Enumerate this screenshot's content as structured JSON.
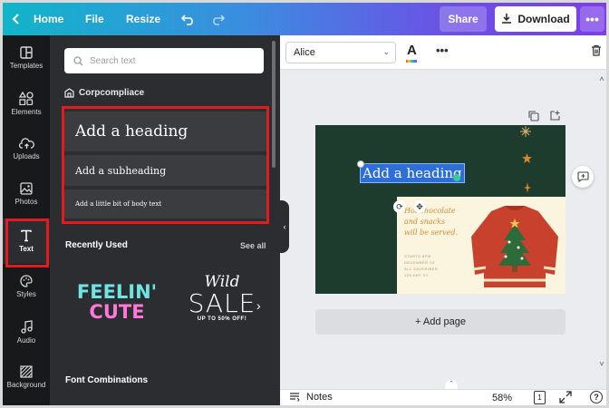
{
  "topbar": {
    "home_label": "Home",
    "file_label": "File",
    "resize_label": "Resize",
    "share_label": "Share",
    "download_label": "Download"
  },
  "rail": {
    "items": [
      {
        "label": "Templates",
        "icon": "templates-icon"
      },
      {
        "label": "Elements",
        "icon": "elements-icon"
      },
      {
        "label": "Uploads",
        "icon": "upload-cloud-icon"
      },
      {
        "label": "Photos",
        "icon": "photos-icon"
      },
      {
        "label": "Text",
        "icon": "text-icon"
      },
      {
        "label": "Styles",
        "icon": "palette-icon"
      },
      {
        "label": "Audio",
        "icon": "music-note-icon"
      },
      {
        "label": "Background",
        "icon": "background-pattern-icon"
      }
    ],
    "active": "Text"
  },
  "panel": {
    "search_placeholder": "Search text",
    "brand_name": "Corpcompliace",
    "heading_label": "Add a heading",
    "subheading_label": "Add a subheading",
    "body_label": "Add a little bit of body text",
    "recently_used_title": "Recently Used",
    "see_all_label": "See all",
    "feelin_line1": "FEELIN'",
    "feelin_line2": "CUTE",
    "wild_label": "Wild",
    "sale_label": "SALE",
    "upto_label": "UP TO 50% OFF!",
    "font_combinations_title": "Font Combinations"
  },
  "toolbar": {
    "font_name": "Alice",
    "color_label": "A"
  },
  "canvas": {
    "selected_text": "Add a heading",
    "script_line1": "Hot chocolate",
    "script_line2": "and snacks",
    "script_line3": "will be served.",
    "info_line1": "STARTS 8PM",
    "info_line2": "DECEMBER 20",
    "info_line3": "ALL SAVERIBEN",
    "info_line4": "123 ANY ST.",
    "add_page_label": "+ Add page"
  },
  "bottombar": {
    "notes_label": "Notes",
    "zoom_label": "58%",
    "page_count": "1",
    "help_label": "?"
  },
  "colors": {
    "selection_red": "#e11b22",
    "panel_bg": "#2b2d31",
    "rail_bg": "#18191b",
    "design_green": "#1d3c2d",
    "selection_blue": "#2c6fd8"
  }
}
